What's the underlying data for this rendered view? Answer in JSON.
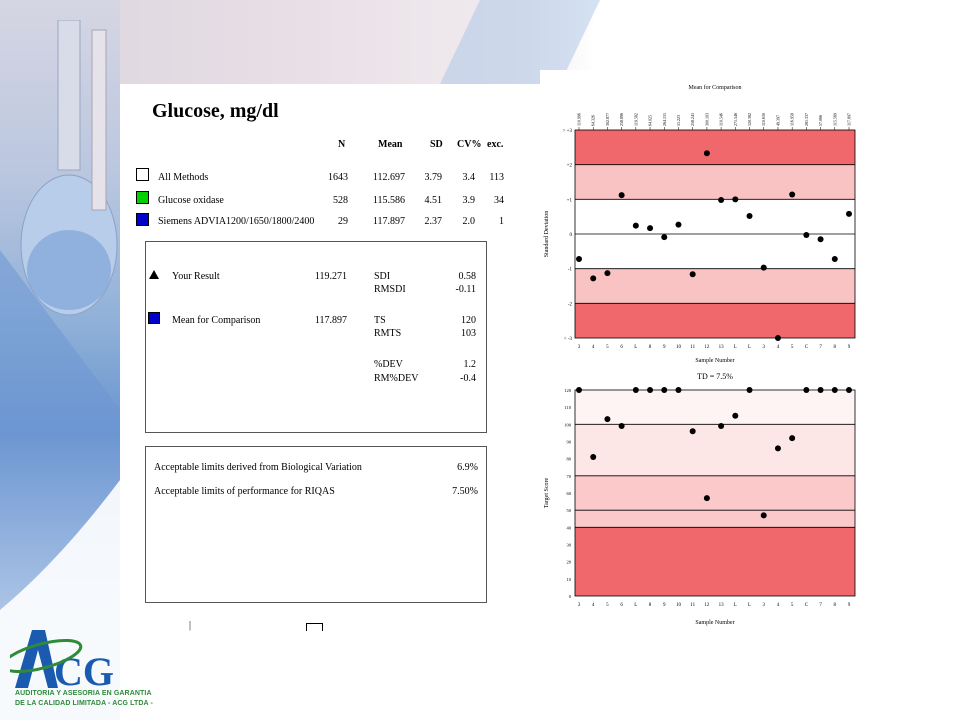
{
  "report": {
    "title": "Glucose, mg/dl",
    "columns": [
      "N",
      "Mean",
      "SD",
      "CV%",
      "exc."
    ],
    "methods": [
      {
        "label": "All Methods",
        "color": "#ffffff",
        "n": "1643",
        "mean": "112.697",
        "sd": "3.79",
        "cv": "3.4",
        "exc": "113"
      },
      {
        "label": "Glucose oxidase",
        "color": "#00d000",
        "n": "528",
        "mean": "115.586",
        "sd": "4.51",
        "cv": "3.9",
        "exc": "34"
      },
      {
        "label": "Siemens ADVIA1200/1650/1800/2400",
        "color": "#0000cc",
        "n": "29",
        "mean": "117.897",
        "sd": "2.37",
        "cv": "2.0",
        "exc": "1"
      }
    ],
    "result_box": {
      "your_result_label": "Your Result",
      "your_result_value": "119.271",
      "mean_label": "Mean for Comparison",
      "mean_value": "117.897",
      "stats": [
        {
          "label": "SDI",
          "value": "0.58"
        },
        {
          "label": "RMSDI",
          "value": "-0.11"
        },
        {
          "label": "TS",
          "value": "120"
        },
        {
          "label": "RMTS",
          "value": "103"
        },
        {
          "label": "%DEV",
          "value": "1.2"
        },
        {
          "label": "RM%DEV",
          "value": "-0.4"
        }
      ]
    },
    "limits_box": {
      "bio_label": "Acceptable limits derived from Biological Variation",
      "bio_value": "6.9%",
      "perf_label": "Acceptable limits of performance for  RIQAS",
      "perf_value": "7.50%"
    },
    "footer_mark": "|"
  },
  "chart_data": [
    {
      "type": "scatter",
      "title": "Mean for Comparison",
      "xlabel": "Sample Number",
      "ylabel": "Standard Deviation",
      "top_labels": [
        "110.996",
        "64.326",
        "302.877",
        "258.896",
        "119.582",
        "64.025",
        "264.131",
        "51.223",
        "258.241",
        "300.103",
        "110.546",
        "271.546",
        "120.382",
        "110.630",
        "49.397",
        "116.958",
        "281.337",
        "57.066",
        "115.589",
        "117.897"
      ],
      "categories": [
        "3",
        "4",
        "5",
        "6",
        "L",
        "8",
        "9",
        "10",
        "11",
        "12",
        "13",
        "L",
        "L",
        "3",
        "4",
        "5",
        "C",
        "7",
        "8",
        "9"
      ],
      "ytick_labels": [
        "> +3",
        "+2",
        "+1",
        "0",
        "-1",
        "-2",
        "< -3"
      ],
      "ylim": [
        -3,
        3
      ],
      "values": [
        -0.72,
        -1.28,
        -1.13,
        1.12,
        0.24,
        0.17,
        -0.09,
        0.27,
        -1.16,
        2.33,
        0.98,
        1.0,
        0.52,
        -0.97,
        -3.0,
        1.14,
        -0.03,
        -0.15,
        -0.72,
        0.58
      ],
      "x_positions": [
        0,
        1,
        2,
        3,
        4,
        5,
        6,
        7,
        8,
        9,
        10,
        11,
        12,
        13,
        13.5,
        14,
        15,
        16,
        17,
        18,
        19
      ],
      "band_colors": [
        "#f0686b",
        "#f9c3c4",
        "#ffffff",
        "#ffffff",
        "#f9c3c4",
        "#f0686b"
      ]
    },
    {
      "type": "scatter",
      "title": "TD = 7.5%",
      "xlabel": "Sample Number",
      "ylabel": "Target Score",
      "categories": [
        "3",
        "4",
        "5",
        "6",
        "L",
        "8",
        "9",
        "10",
        "11",
        "12",
        "13",
        "L",
        "L",
        "3",
        "4",
        "5",
        "C",
        "7",
        "8",
        "9"
      ],
      "ytick_labels": [
        "0",
        "10",
        "20",
        "30",
        "40",
        "50",
        "60",
        "70",
        "80",
        "90",
        "100",
        "110",
        "120"
      ],
      "ylim": [
        0,
        120
      ],
      "values": [
        120,
        81,
        103,
        99,
        120,
        120,
        120,
        120,
        96,
        57,
        99,
        105,
        120,
        47,
        86,
        92,
        120,
        120,
        120,
        120
      ],
      "band_colors": [
        "#f0686b",
        "#fbc9ca",
        "#fde6e6",
        "#fff4f4"
      ]
    }
  ],
  "logo": {
    "text": "ACG",
    "tagline_1": "AUDITORIA Y ASESORIA EN GARANTIA",
    "tagline_2": "DE LA CALIDAD LIMITADA - ACG LTDA -",
    "blue": "#1a5bb0",
    "green": "#2f8a3a"
  }
}
